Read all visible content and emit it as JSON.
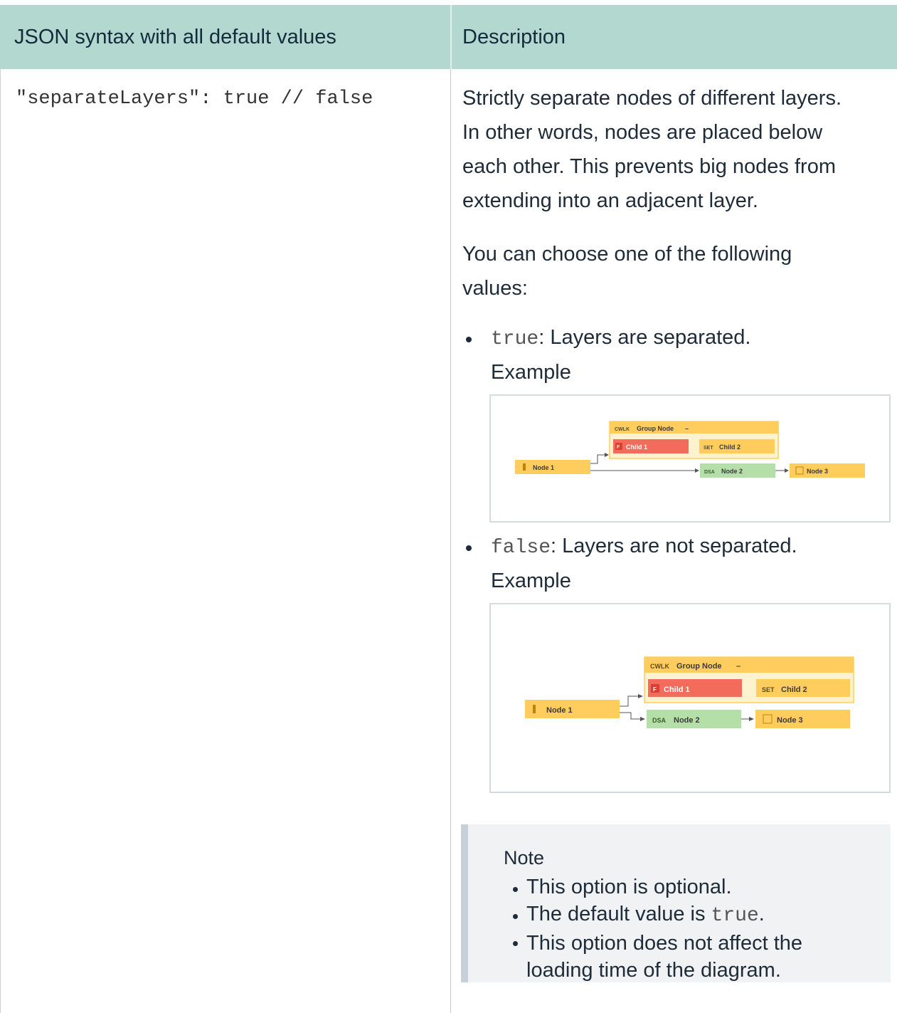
{
  "header": {
    "col1": "JSON syntax with all default values",
    "col2": "Description"
  },
  "row": {
    "code": "\"separateLayers\": true // false",
    "desc_p1_lines": [
      "Strictly separate nodes of different layers.",
      "In other words, nodes are placed below",
      "each other. This prevents big nodes from",
      "extending into an adjacent layer."
    ],
    "desc_p2_lines": [
      "You can choose one of the following",
      "values:"
    ],
    "options": [
      {
        "code": "true",
        "text": ": Layers are separated.",
        "example_label": "Example"
      },
      {
        "code": "false",
        "text": ": Layers are not separated.",
        "example_label": "Example"
      }
    ],
    "diagram": {
      "group_badge": "CWLK",
      "group_title": "Group Node",
      "group_collapse": "–",
      "child1_badge": "F",
      "child1": "Child 1",
      "child2_badge": "SET",
      "child2": "Child 2",
      "node1": "Node 1",
      "node2_badge": "DSA",
      "node2": "Node 2",
      "node3": "Node 3"
    },
    "note": {
      "title": "Note",
      "item1": "This option is optional.",
      "item2_prefix": "The default value is ",
      "item2_code": "true",
      "item2_suffix": ".",
      "item3_lines": [
        "This option does not affect the",
        "loading time of the diagram."
      ]
    }
  },
  "colors": {
    "header_bg": "#b3d8d0",
    "node_yellow": "#ffcd5e",
    "child_red": "#f26b5b",
    "node_green": "#b5dfa8",
    "group_bg": "#fff3cf"
  }
}
